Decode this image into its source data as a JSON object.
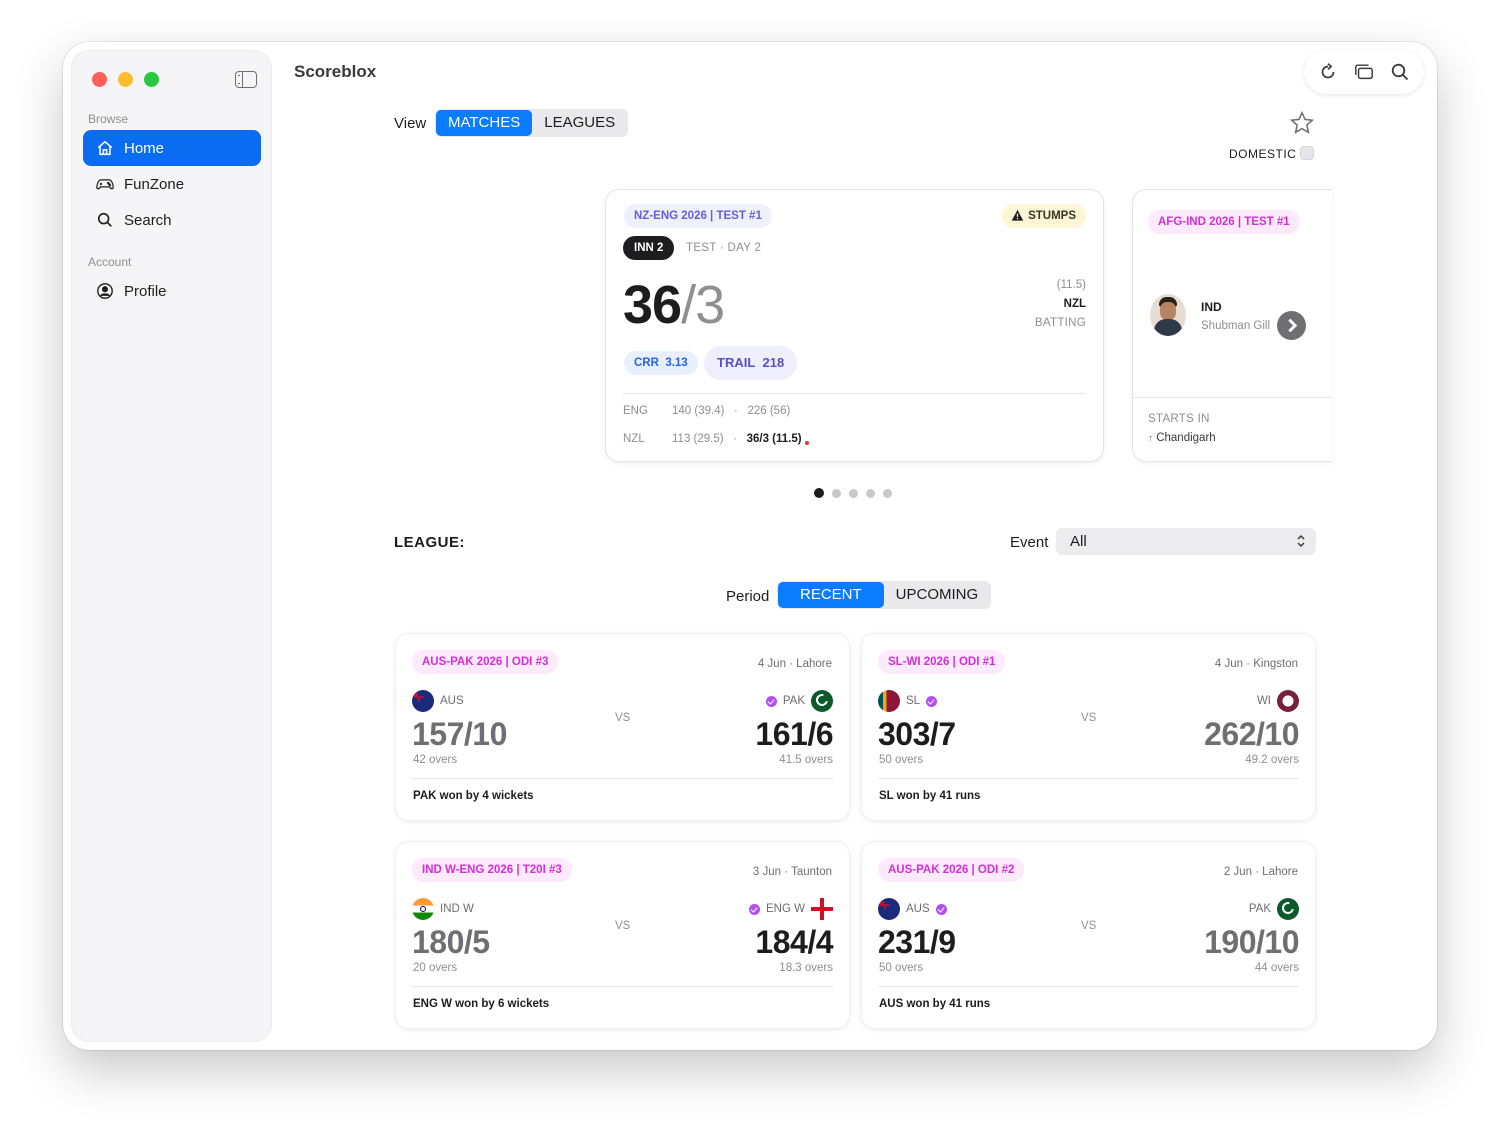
{
  "app": {
    "title": "Scoreblox"
  },
  "sidebar": {
    "browse_label": "Browse",
    "account_label": "Account",
    "items": [
      {
        "label": "Home",
        "icon": "house-icon",
        "active": true
      },
      {
        "label": "FunZone",
        "icon": "gamecontroller-icon"
      },
      {
        "label": "Search",
        "icon": "magnifyingglass-icon"
      },
      {
        "label": "Profile",
        "icon": "person-circle-icon"
      }
    ]
  },
  "toolbar": {
    "icons": [
      "refresh-icon",
      "windows-icon",
      "search-icon"
    ]
  },
  "view": {
    "label": "View",
    "options": [
      "MATCHES",
      "LEAGUES"
    ],
    "selected": "MATCHES"
  },
  "filter": {
    "domestic_label": "DOMESTIC",
    "domestic_checked": false
  },
  "live_match": {
    "tag": "NZ-ENG 2026 | TEST #1",
    "status": "STUMPS",
    "innings": "INN 2",
    "format": "TEST · DAY 2",
    "runs": "36",
    "wickets": "/3",
    "overs": "(11.5)",
    "batting_team": "NZL",
    "batting_label": "BATTING",
    "crr_label": "CRR",
    "crr": "3.13",
    "trail_label": "TRAIL",
    "trail": "218",
    "innings_lines": [
      {
        "team": "ENG",
        "first": "140 (39.4)",
        "sep": "·",
        "second": "226 (56)"
      },
      {
        "team": "NZL",
        "first": "113 (29.5)",
        "sep": "·",
        "second": "36/3 (11.5)"
      }
    ]
  },
  "upcoming_match": {
    "tag": "AFG-IND 2026 | TEST #1",
    "team": "IND",
    "player": "Shubman Gill",
    "starts_label": "STARTS IN",
    "venue": "Chandigarh"
  },
  "carousel": {
    "pages": 5,
    "current": 1
  },
  "league": {
    "label": "LEAGUE:",
    "event_label": "Event",
    "event_value": "All"
  },
  "period": {
    "label": "Period",
    "options": [
      "RECENT",
      "UPCOMING"
    ],
    "selected": "RECENT"
  },
  "matches": [
    {
      "tag": "AUS-PAK 2026 | ODI #3",
      "meta": "4 Jun · Lahore",
      "home": {
        "name": "AUS",
        "score": "157/10",
        "overs": "42 overs",
        "verified": false
      },
      "away": {
        "name": "PAK",
        "score": "161/6",
        "overs": "41.5 overs",
        "verified": true
      },
      "vs": "VS",
      "winner": "away",
      "result": "PAK won by 4 wickets"
    },
    {
      "tag": "SL-WI 2026 | ODI #1",
      "meta": "4 Jun · Kingston",
      "home": {
        "name": "SL",
        "score": "303/7",
        "overs": "50 overs",
        "verified": true
      },
      "away": {
        "name": "WI",
        "score": "262/10",
        "overs": "49.2 overs",
        "verified": false
      },
      "vs": "VS",
      "winner": "home",
      "result": "SL won by 41 runs"
    },
    {
      "tag": "IND W-ENG 2026 | T20I #3",
      "meta": "3 Jun · Taunton",
      "home": {
        "name": "IND W",
        "score": "180/5",
        "overs": "20 overs",
        "verified": false
      },
      "away": {
        "name": "ENG W",
        "score": "184/4",
        "overs": "18.3 overs",
        "verified": true
      },
      "vs": "VS",
      "winner": "away",
      "result": "ENG W won by 6 wickets"
    },
    {
      "tag": "AUS-PAK 2026 | ODI #2",
      "meta": "2 Jun · Lahore",
      "home": {
        "name": "AUS",
        "score": "231/9",
        "overs": "50 overs",
        "verified": true
      },
      "away": {
        "name": "PAK",
        "score": "190/10",
        "overs": "44 overs",
        "verified": false
      },
      "vs": "VS",
      "winner": "home",
      "result": "AUS won by 41 runs"
    }
  ],
  "colors": {
    "accent": "#0a7cff",
    "sidebar_active": "#0a6cf0",
    "tag_pink": "#d42fd6",
    "live_red": "#e5352b"
  }
}
